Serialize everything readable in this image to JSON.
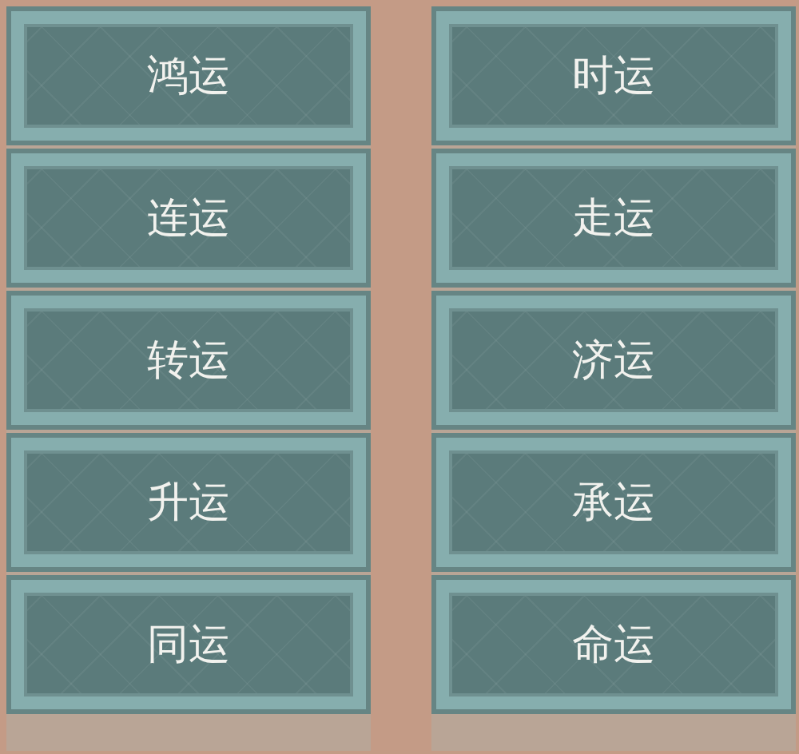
{
  "columns": [
    {
      "tiles": [
        "鸿运",
        "连运",
        "转运",
        "升运",
        "同运"
      ]
    },
    {
      "tiles": [
        "时运",
        "走运",
        "济运",
        "承运",
        "命运"
      ]
    }
  ]
}
